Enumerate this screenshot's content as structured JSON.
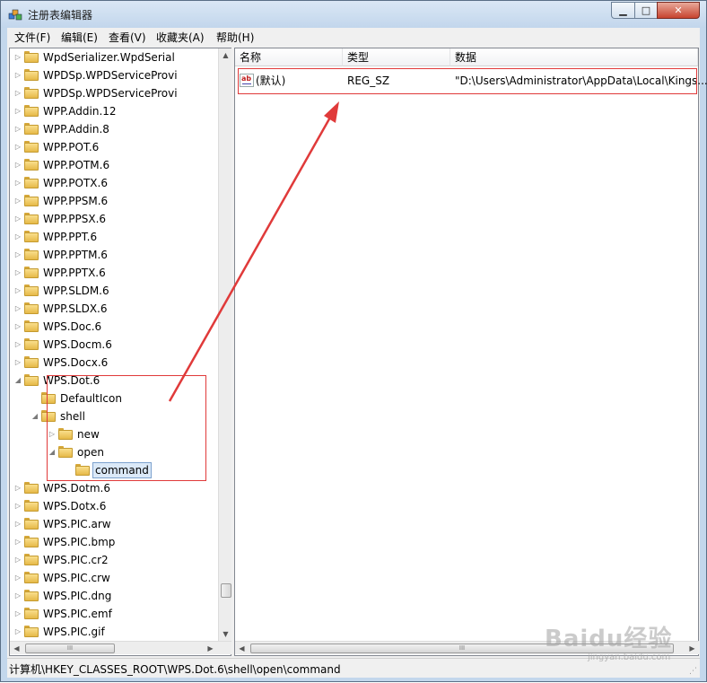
{
  "window": {
    "title": "注册表编辑器",
    "min_label": "▁",
    "max_label": "□",
    "close_label": "✕"
  },
  "menu": [
    "文件(F)",
    "编辑(E)",
    "查看(V)",
    "收藏夹(A)",
    "帮助(H)"
  ],
  "tree": {
    "items": [
      {
        "label": "WpdSerializer.WpdSerial",
        "expander": "▷"
      },
      {
        "label": "WPDSp.WPDServiceProvi",
        "expander": "▷"
      },
      {
        "label": "WPDSp.WPDServiceProvi",
        "expander": "▷"
      },
      {
        "label": "WPP.Addin.12",
        "expander": "▷"
      },
      {
        "label": "WPP.Addin.8",
        "expander": "▷"
      },
      {
        "label": "WPP.POT.6",
        "expander": "▷"
      },
      {
        "label": "WPP.POTM.6",
        "expander": "▷"
      },
      {
        "label": "WPP.POTX.6",
        "expander": "▷"
      },
      {
        "label": "WPP.PPSM.6",
        "expander": "▷"
      },
      {
        "label": "WPP.PPSX.6",
        "expander": "▷"
      },
      {
        "label": "WPP.PPT.6",
        "expander": "▷"
      },
      {
        "label": "WPP.PPTM.6",
        "expander": "▷"
      },
      {
        "label": "WPP.PPTX.6",
        "expander": "▷"
      },
      {
        "label": "WPP.SLDM.6",
        "expander": "▷"
      },
      {
        "label": "WPP.SLDX.6",
        "expander": "▷"
      },
      {
        "label": "WPS.Doc.6",
        "expander": "▷"
      },
      {
        "label": "WPS.Docm.6",
        "expander": "▷"
      },
      {
        "label": "WPS.Docx.6",
        "expander": "▷"
      },
      {
        "label": "WPS.Dot.6",
        "expander": "◢"
      },
      {
        "label": "DefaultIcon",
        "expander": ""
      },
      {
        "label": "shell",
        "expander": "◢"
      },
      {
        "label": "new",
        "expander": "▷"
      },
      {
        "label": "open",
        "expander": "◢"
      },
      {
        "label": "command",
        "expander": ""
      },
      {
        "label": "WPS.Dotm.6",
        "expander": "▷"
      },
      {
        "label": "WPS.Dotx.6",
        "expander": "▷"
      },
      {
        "label": "WPS.PIC.arw",
        "expander": "▷"
      },
      {
        "label": "WPS.PIC.bmp",
        "expander": "▷"
      },
      {
        "label": "WPS.PIC.cr2",
        "expander": "▷"
      },
      {
        "label": "WPS.PIC.crw",
        "expander": "▷"
      },
      {
        "label": "WPS.PIC.dng",
        "expander": "▷"
      },
      {
        "label": "WPS.PIC.emf",
        "expander": "▷"
      },
      {
        "label": "WPS.PIC.gif",
        "expander": "▷"
      }
    ],
    "scroll_up": "▲",
    "scroll_down": "▼",
    "scroll_left": "◀",
    "scroll_right": "▶",
    "thumb_grip": "III"
  },
  "list": {
    "headers": {
      "name": "名称",
      "type": "类型",
      "data": "数据"
    },
    "rows": [
      {
        "icon": "ab",
        "name": "(默认)",
        "type": "REG_SZ",
        "data": "\"D:\\Users\\Administrator\\AppData\\Local\\Kings..."
      }
    ],
    "thumb_grip": "III",
    "scroll_left": "◀",
    "scroll_right": "▶"
  },
  "status": {
    "path": "计算机\\HKEY_CLASSES_ROOT\\WPS.Dot.6\\shell\\open\\command"
  },
  "watermark": {
    "text": "Baidu经验",
    "sub": "jingyan.baidu.com"
  },
  "colors": {
    "annotation_red": "#e03a3a",
    "folder_yellow": "#f9df8c",
    "selection_blue": "#dbe9f8"
  }
}
